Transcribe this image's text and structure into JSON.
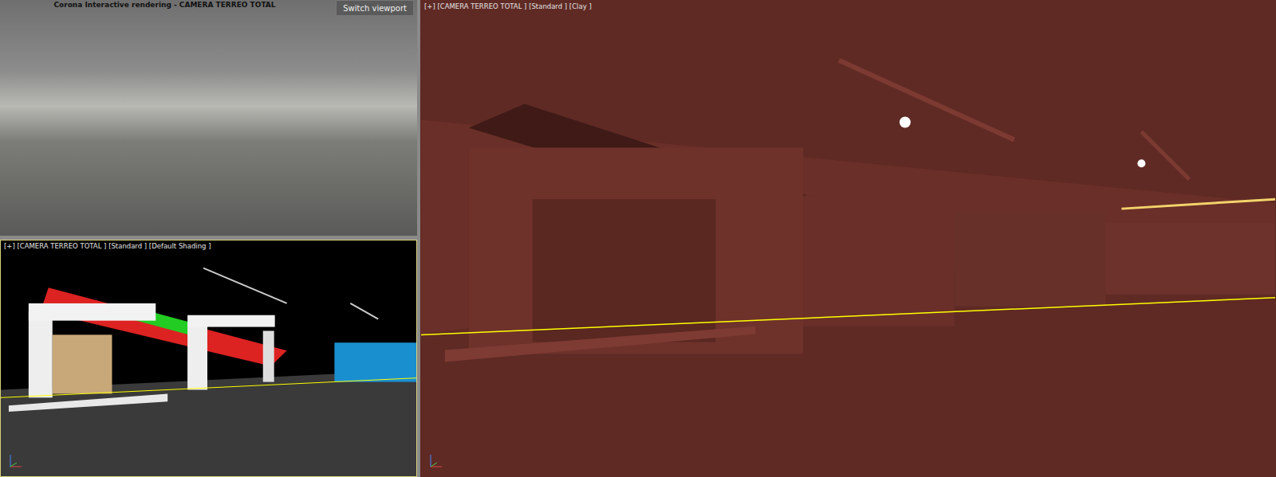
{
  "render_window": {
    "title": "Corona Interactive rendering - CAMERA TERREO TOTAL",
    "button": "Switch viewport"
  },
  "viewports": [
    {
      "label": "[+] [CAMERA TERREO TOTAL ] [Standard ] [Default Shading ]",
      "kind": "shaded",
      "active": true
    },
    {
      "label": "[+] [CAMERA TERREO TOTAL ] [Standard ] [Clay ]",
      "kind": "clay",
      "active": false
    }
  ]
}
